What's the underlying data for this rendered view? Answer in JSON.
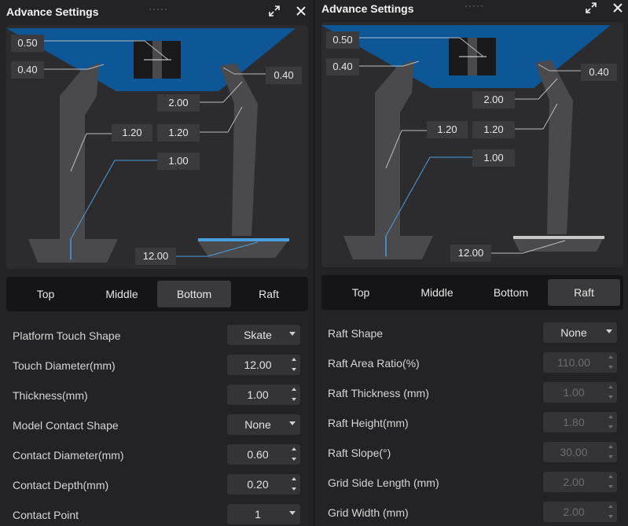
{
  "left": {
    "title": "Advance Settings",
    "handle": "·····",
    "tabs": [
      {
        "label": "Top"
      },
      {
        "label": "Middle"
      },
      {
        "label": "Bottom"
      },
      {
        "label": "Raft"
      }
    ],
    "active_tab": "Bottom",
    "diagram_labels": {
      "top_thickness": "0.50",
      "contact_left": "0.40",
      "contact_right": "0.40",
      "upper_diameter": "2.00",
      "left_diameter": "1.20",
      "right_diameter": "1.20",
      "bottom_thickness": "1.00",
      "base_diameter": "12.00"
    },
    "settings": [
      {
        "label": "Platform Touch Shape",
        "value": "Skate",
        "type": "select"
      },
      {
        "label": "Touch Diameter(mm)",
        "value": "12.00",
        "type": "spin"
      },
      {
        "label": "Thickness(mm)",
        "value": "1.00",
        "type": "spin"
      },
      {
        "label": "Model Contact Shape",
        "value": "None",
        "type": "select"
      },
      {
        "label": "Contact Diameter(mm)",
        "value": "0.60",
        "type": "spin"
      },
      {
        "label": "Contact Depth(mm)",
        "value": "0.20",
        "type": "spin"
      },
      {
        "label": "Contact Point",
        "value": "1",
        "type": "select"
      }
    ]
  },
  "right": {
    "title": "Advance Settings",
    "handle": "·····",
    "tabs": [
      {
        "label": "Top"
      },
      {
        "label": "Middle"
      },
      {
        "label": "Bottom"
      },
      {
        "label": "Raft"
      }
    ],
    "active_tab": "Raft",
    "diagram_labels": {
      "top_thickness": "0.50",
      "contact_left": "0.40",
      "contact_right": "0.40",
      "upper_diameter": "2.00",
      "left_diameter": "1.20",
      "right_diameter": "1.20",
      "bottom_thickness": "1.00",
      "base_diameter": "12.00"
    },
    "settings": [
      {
        "label": "Raft Shape",
        "value": "None",
        "type": "select"
      },
      {
        "label": "Raft Area Ratio(%)",
        "value": "110.00",
        "type": "spin",
        "disabled": true
      },
      {
        "label": "Raft Thickness (mm)",
        "value": "1.00",
        "type": "spin",
        "disabled": true
      },
      {
        "label": "Raft Height(mm)",
        "value": "1.80",
        "type": "spin",
        "disabled": true
      },
      {
        "label": "Raft Slope(°)",
        "value": "30.00",
        "type": "spin",
        "disabled": true
      },
      {
        "label": "Grid Side Length (mm)",
        "value": "2.00",
        "type": "spin",
        "disabled": true
      },
      {
        "label": "Grid Width (mm)",
        "value": "2.00",
        "type": "spin",
        "disabled": true
      }
    ]
  },
  "colors": {
    "model": "#0d5797",
    "support": "#4a4a4c",
    "highlight": "#4a9fe0",
    "panel": "#232325"
  }
}
